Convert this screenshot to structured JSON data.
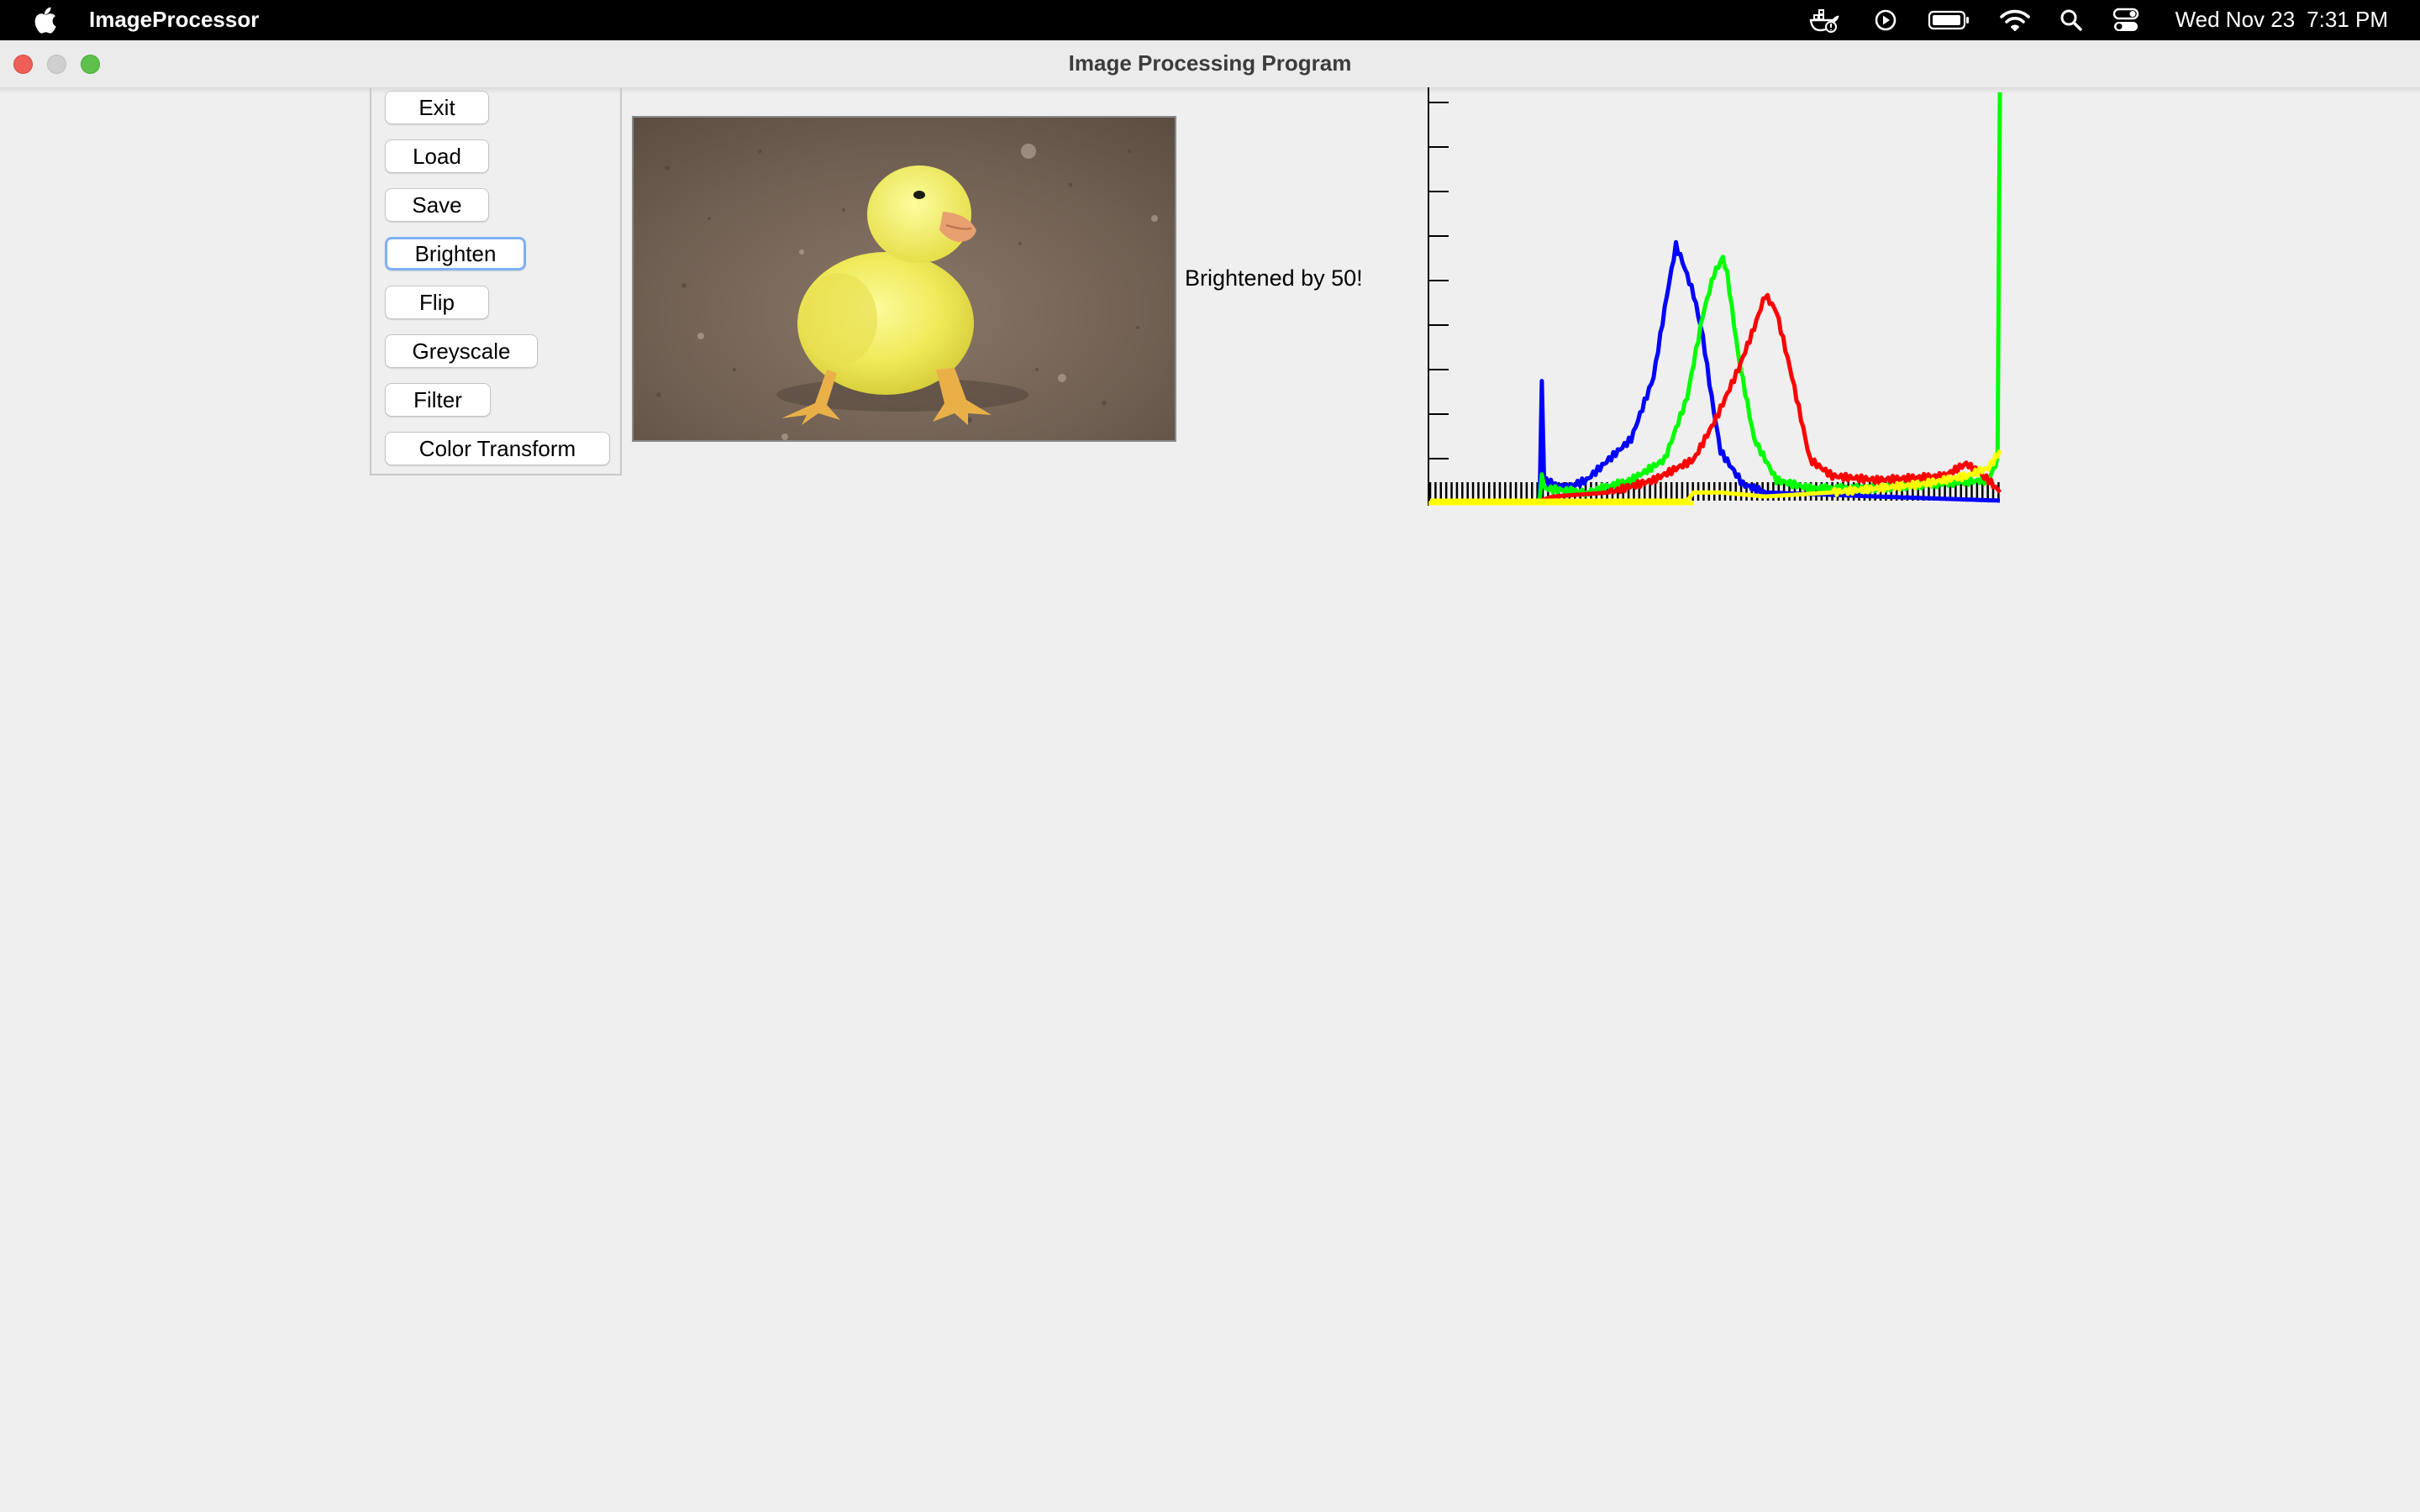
{
  "menubar": {
    "app_name": "ImageProcessor",
    "status_icons": [
      "docker-icon",
      "play-circle-icon",
      "battery-icon",
      "wifi-icon",
      "search-icon",
      "control-center-icon"
    ],
    "clock": {
      "date": "Wed Nov 23",
      "time": "7:31 PM"
    }
  },
  "window": {
    "title": "Image Processing Program",
    "controls": [
      "close",
      "minimize",
      "zoom"
    ]
  },
  "buttons": [
    {
      "id": "exit",
      "label": "Exit",
      "focused": false
    },
    {
      "id": "load",
      "label": "Load",
      "focused": false
    },
    {
      "id": "save",
      "label": "Save",
      "focused": false
    },
    {
      "id": "brighten",
      "label": "Brighten",
      "focused": true
    },
    {
      "id": "flip",
      "label": "Flip",
      "focused": false
    },
    {
      "id": "greyscale",
      "label": "Greyscale",
      "focused": false
    },
    {
      "id": "filter",
      "label": "Filter",
      "focused": false
    },
    {
      "id": "color-transform",
      "label": "Color Transform",
      "focused": false
    }
  ],
  "preview": {
    "subject": "yellow duckling on dirt ground"
  },
  "status_message": "Brightened by 50!",
  "chart_data": {
    "type": "line",
    "title": "",
    "xlabel": "",
    "ylabel": "",
    "xlim": [
      0,
      255
    ],
    "x_ticks_visible": false,
    "y_tick_count": 10,
    "legend": "none",
    "series": [
      {
        "color": "#0000ff",
        "points": [
          [
            0,
            0
          ],
          [
            49,
            0
          ],
          [
            50,
            0.29
          ],
          [
            51,
            0.05
          ],
          [
            60,
            0.03
          ],
          [
            70,
            0.05
          ],
          [
            80,
            0.1
          ],
          [
            90,
            0.15
          ],
          [
            100,
            0.3
          ],
          [
            106,
            0.5
          ],
          [
            110,
            0.62
          ],
          [
            113,
            0.58
          ],
          [
            118,
            0.5
          ],
          [
            122,
            0.4
          ],
          [
            126,
            0.25
          ],
          [
            130,
            0.12
          ],
          [
            140,
            0.04
          ],
          [
            150,
            0.02
          ],
          [
            200,
            0.01
          ],
          [
            255,
            0
          ]
        ]
      },
      {
        "color": "#00ff00",
        "points": [
          [
            0,
            0
          ],
          [
            49,
            0
          ],
          [
            50,
            0.07
          ],
          [
            51,
            0.03
          ],
          [
            70,
            0.02
          ],
          [
            90,
            0.05
          ],
          [
            105,
            0.1
          ],
          [
            115,
            0.25
          ],
          [
            122,
            0.45
          ],
          [
            127,
            0.55
          ],
          [
            131,
            0.59
          ],
          [
            133,
            0.55
          ],
          [
            138,
            0.35
          ],
          [
            145,
            0.15
          ],
          [
            155,
            0.05
          ],
          [
            170,
            0.03
          ],
          [
            200,
            0.03
          ],
          [
            250,
            0.05
          ],
          [
            254,
            0.1
          ],
          [
            255,
            1.0
          ]
        ]
      },
      {
        "color": "#ff0000",
        "points": [
          [
            0,
            0
          ],
          [
            49,
            0
          ],
          [
            55,
            0.01
          ],
          [
            80,
            0.02
          ],
          [
            100,
            0.05
          ],
          [
            118,
            0.1
          ],
          [
            128,
            0.2
          ],
          [
            138,
            0.32
          ],
          [
            145,
            0.42
          ],
          [
            150,
            0.5
          ],
          [
            155,
            0.46
          ],
          [
            162,
            0.3
          ],
          [
            170,
            0.1
          ],
          [
            180,
            0.06
          ],
          [
            200,
            0.05
          ],
          [
            230,
            0.06
          ],
          [
            240,
            0.09
          ],
          [
            250,
            0.05
          ],
          [
            255,
            0.02
          ]
        ]
      },
      {
        "color": "#ffff00",
        "points": [
          [
            0,
            0
          ],
          [
            115,
            0
          ],
          [
            118,
            0.02
          ],
          [
            130,
            0.02
          ],
          [
            150,
            0.01
          ],
          [
            180,
            0.02
          ],
          [
            200,
            0.03
          ],
          [
            220,
            0.04
          ],
          [
            240,
            0.06
          ],
          [
            250,
            0.08
          ],
          [
            255,
            0.12
          ]
        ]
      }
    ],
    "baseline_series": {
      "color": "#000000",
      "note": "intensity bars near zero",
      "range": [
        0,
        255
      ]
    }
  }
}
